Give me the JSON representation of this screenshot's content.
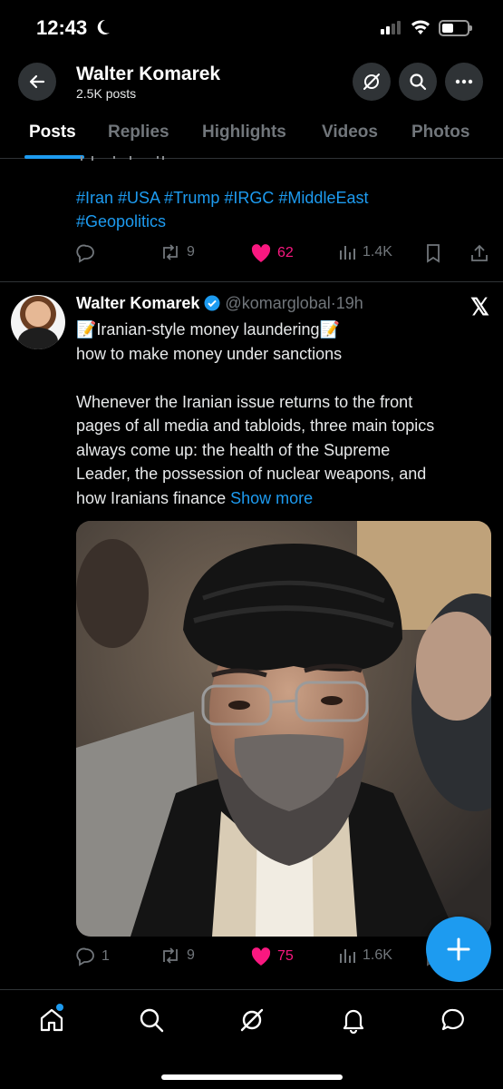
{
  "status_bar": {
    "time": "12:43"
  },
  "header": {
    "title": "Walter Komarek",
    "subtitle": "2.5K posts"
  },
  "tabs": [
    "Posts",
    "Replies",
    "Highlights",
    "Videos",
    "Photos"
  ],
  "tweet1": {
    "hashtags_line1": "#Iran #USA #Trump #IRGC #MiddleEast",
    "hashtags_line2": "#Geopolitics",
    "retweets": "9",
    "likes": "62",
    "views": "1.4K"
  },
  "tweet2": {
    "name": "Walter Komarek",
    "handle": "@komarglobal",
    "time": "19h",
    "line1": "📝Iranian-style money laundering📝",
    "line2": "how to make money under sanctions",
    "para1": "Whenever the Iranian issue returns to the front",
    "para2": "pages of all media and tabloids, three main topics",
    "para3": "always come up: the health of the Supreme",
    "para4": "Leader, the possession of nuclear weapons, and",
    "para5": "how Iranians finance",
    "show_more": "Show more",
    "replies": "1",
    "retweets": "9",
    "likes": "75",
    "views": "1.6K"
  },
  "colors": {
    "accent": "#1d9bf0",
    "like": "#f91880",
    "muted": "#71767b",
    "background": "#000000"
  },
  "icons": [
    "back-arrow-icon",
    "grok-icon",
    "search-icon",
    "more-icon",
    "reply-icon",
    "retweet-icon",
    "heart-icon",
    "views-icon",
    "bookmark-icon",
    "share-icon",
    "verified-badge-icon",
    "x-logo-icon",
    "compose-plus-icon",
    "home-icon",
    "explore-icon",
    "notifications-icon",
    "messages-icon"
  ]
}
